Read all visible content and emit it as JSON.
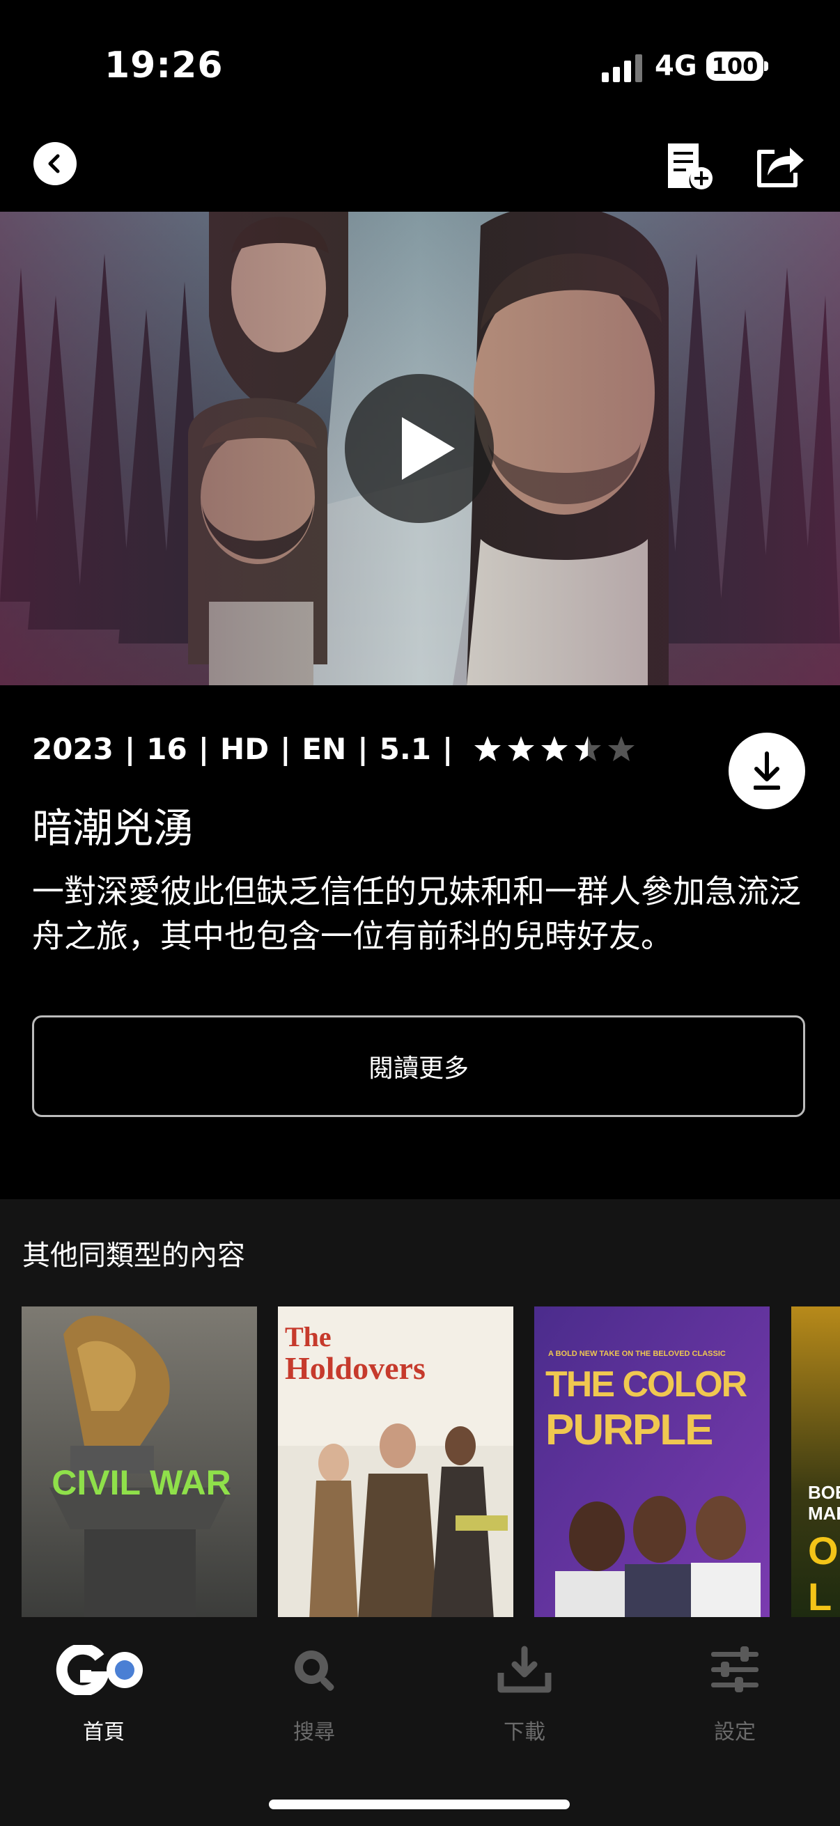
{
  "status_bar": {
    "time": "19:26",
    "network": "4G",
    "battery": "100"
  },
  "movie": {
    "year": "2023",
    "rating_age": "16",
    "quality": "HD",
    "language": "EN",
    "audio": "5.1",
    "star_rating": 3.5,
    "title": "暗潮兇湧",
    "description": "一對深愛彼此但缺乏信任的兄妹和和一群人參加急流泛舟之旅，其中也包含一位有前科的兒時好友。"
  },
  "buttons": {
    "read_more": "閱讀更多"
  },
  "related": {
    "title": "其他同類型的內容",
    "posters": [
      {
        "text": "CIVIL WAR"
      },
      {
        "text_line1": "The",
        "text_line2": "Holdovers"
      },
      {
        "tagline": "A BOLD NEW TAKE ON THE BELOVED CLASSIC",
        "text_line1": "THE COLOR",
        "text_line2": "PURPLE"
      },
      {
        "text_line1": "BOB",
        "text_line2": "MAR",
        "text_line3": "ON",
        "text_line4": "L"
      }
    ]
  },
  "nav": {
    "items": [
      {
        "label": "首頁",
        "icon": "go-logo-icon",
        "active": true
      },
      {
        "label": "搜尋",
        "icon": "search-icon",
        "active": false
      },
      {
        "label": "下載",
        "icon": "download-icon",
        "active": false
      },
      {
        "label": "設定",
        "icon": "settings-icon",
        "active": false
      }
    ]
  },
  "colors": {
    "background": "#000000",
    "panel": "#141414",
    "accent": "#4a7fd4",
    "inactive": "#6b6b6b"
  }
}
